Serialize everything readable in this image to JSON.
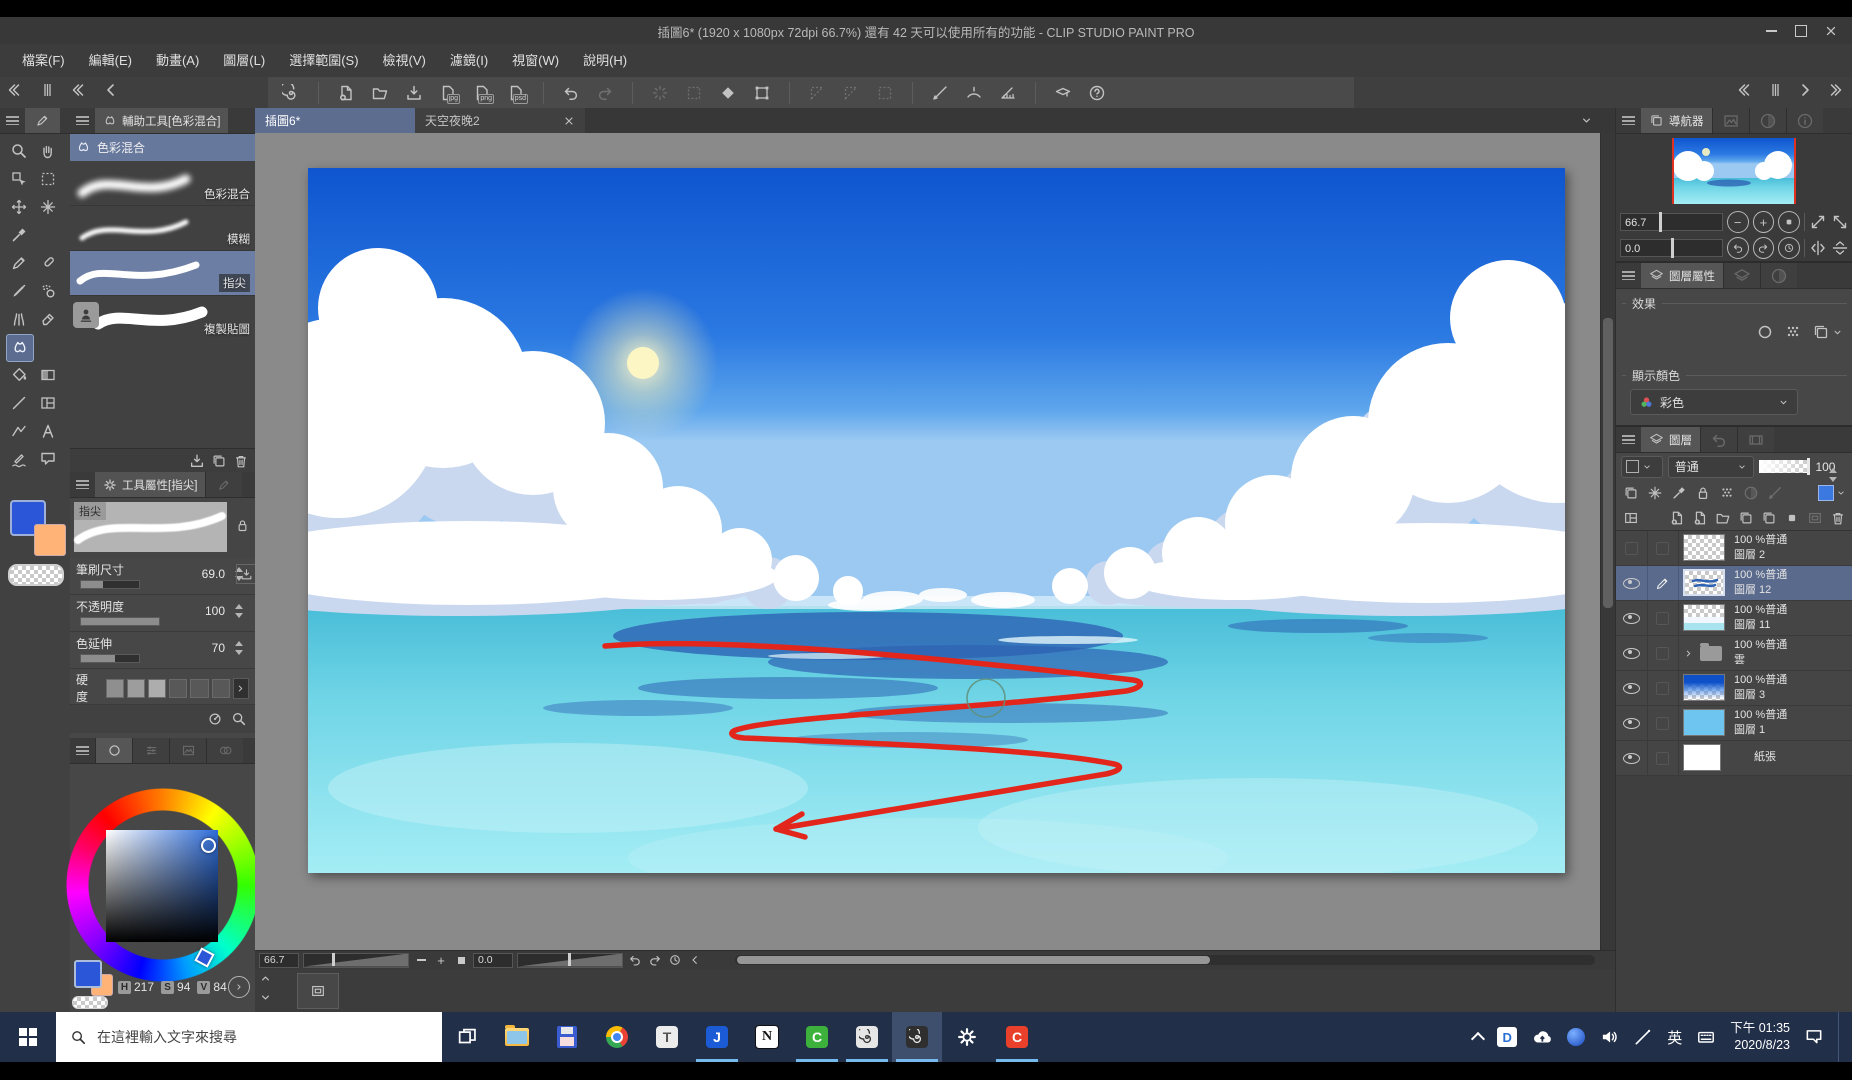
{
  "window": {
    "title": "插圖6* (1920 x 1080px 72dpi 66.7%)  還有 42 天可以使用所有的功能 - CLIP STUDIO PAINT PRO"
  },
  "menu": {
    "items": [
      "檔案(F)",
      "編輯(E)",
      "動畫(A)",
      "圖層(L)",
      "選擇範圍(S)",
      "檢視(V)",
      "濾鏡(I)",
      "視窗(W)",
      "說明(H)"
    ]
  },
  "toolbar": {
    "export_jpg": "jpg",
    "export_png": "png",
    "export_psd": "psd"
  },
  "tabs": {
    "doc1": "插圖6*",
    "doc2": "天空夜晚2"
  },
  "subtool": {
    "title": "輔助工具[色彩混合]",
    "group": "色彩混合",
    "items": [
      "色彩混合",
      "模糊",
      "指尖",
      "複製貼圖"
    ]
  },
  "tool_property": {
    "title": "工具屬性[指尖]",
    "tool_chip": "指尖",
    "brush_size_label": "筆刷尺寸",
    "brush_size": "69.0",
    "opacity_label": "不透明度",
    "opacity": "100",
    "color_stretch_label": "色延伸",
    "color_stretch": "70",
    "hardness_label": "硬度"
  },
  "color_panel": {
    "h_label": "H",
    "h": "217",
    "s_label": "S",
    "s": "94",
    "v_label": "V",
    "v": "84",
    "primary": "#2b56d8",
    "secondary": "#ffb377"
  },
  "navigator": {
    "tab": "導航器",
    "zoom": "66.7",
    "rotation": "0.0"
  },
  "layer_property": {
    "tab": "圖層屬性",
    "effect": "效果",
    "display_color": "顯示顏色",
    "color_mode": "彩色"
  },
  "layers_panel": {
    "tab": "圖層",
    "blend_mode": "普通",
    "opacity": "100",
    "rows": [
      {
        "info": "100 %普通",
        "name": "圖層 2"
      },
      {
        "info": "100 %普通",
        "name": "圖層 12"
      },
      {
        "info": "100 %普通",
        "name": "圖層 11"
      },
      {
        "info": "100 %普通",
        "name": "雲"
      },
      {
        "info": "100 %普通",
        "name": "圖層 3"
      },
      {
        "info": "100 %普通",
        "name": "圖層 1"
      },
      {
        "name": "紙張"
      }
    ]
  },
  "canvas_status": {
    "zoom": "66.7",
    "rotation": "0.0"
  },
  "taskbar": {
    "search_placeholder": "在這裡輸入文字來搜尋",
    "ime": "英",
    "time": "下午 01:35",
    "date": "2020/8/23",
    "apps": {
      "t": "T",
      "j": "J",
      "n": "N",
      "c_green": "C",
      "c_red": "C",
      "d": "D"
    }
  }
}
